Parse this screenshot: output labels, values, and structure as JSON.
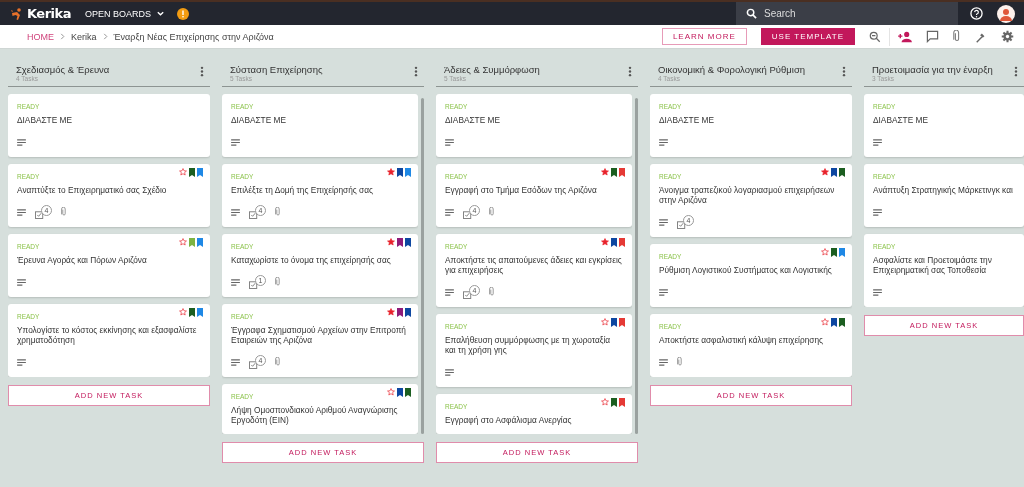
{
  "topbar": {
    "brand": "Kerika",
    "menu": "OPEN BOARDS",
    "search": {
      "placeholder": "Search"
    }
  },
  "breadcrumb": [
    {
      "label": "HOME",
      "kind": "link"
    },
    {
      "label": "Kerika",
      "kind": "text"
    },
    {
      "label": "Έναρξη Νέας Επιχείρησης στην Αριζόνα",
      "kind": "text"
    }
  ],
  "actions": [
    {
      "label": "LEARN MORE",
      "kind": "outline"
    },
    {
      "label": "USE TEMPLATE",
      "kind": "filled"
    }
  ],
  "columns": [
    {
      "title": "Σχεδιασμός & Έρευνα",
      "count": "4 Tasks",
      "scrollbar": false,
      "add_label": "ADD NEW TASK",
      "cards": [
        {
          "status": "READY",
          "title": "ΔΙΑΒΑΣΤΕ ΜΕ",
          "description": true,
          "attachment": false
        },
        {
          "status": "READY",
          "title": "Αναπτύξτε το Επιχειρηματικό σας Σχέδιο",
          "starred": false,
          "tags": [
            {
              "color": "#1b5e20"
            },
            {
              "color": "#1e88e5"
            }
          ],
          "description": true,
          "checklist": "4",
          "attachment": true
        },
        {
          "status": "READY",
          "title": "Έρευνα Αγοράς και Πόρων Αριζόνα",
          "starred": false,
          "tags": [
            {
              "color": "#7cb342"
            },
            {
              "color": "#1e88e5"
            }
          ],
          "description": true,
          "attachment": false
        },
        {
          "status": "READY",
          "title": "Υπολογίστε το κόστος εκκίνησης και εξασφαλίστε χρηματοδότηση",
          "starred": false,
          "tags": [
            {
              "color": "#1b5e20"
            },
            {
              "color": "#1e88e5"
            }
          ],
          "description": true,
          "attachment": false
        }
      ]
    },
    {
      "title": "Σύσταση Επιχείρησης",
      "count": "5 Tasks",
      "scrollbar": true,
      "add_label": "ADD NEW TASK",
      "cards": [
        {
          "status": "READY",
          "title": "ΔΙΑΒΑΣΤΕ ΜΕ",
          "description": true,
          "attachment": false
        },
        {
          "status": "READY",
          "title": "Επιλέξτε τη Δομή της Επιχείρησής σας",
          "starred": true,
          "tags": [
            {
              "color": "#0d47a1"
            },
            {
              "color": "#1e88e5"
            }
          ],
          "description": true,
          "checklist": "4",
          "attachment": true
        },
        {
          "status": "READY",
          "title": "Καταχωρίστε το όνομα της επιχείρησής σας",
          "starred": true,
          "tags": [
            {
              "color": "#8e1b7a"
            },
            {
              "color": "#0d47a1"
            }
          ],
          "description": true,
          "checklist": "1",
          "attachment": true
        },
        {
          "status": "READY",
          "title": "Έγγραφα Σχηματισμού Αρχείων στην Επιτροπή Εταιρειών της Αριζόνα",
          "starred": true,
          "tags": [
            {
              "color": "#8e1b7a"
            },
            {
              "color": "#0d47a1"
            }
          ],
          "description": true,
          "checklist": "4",
          "attachment": true
        },
        {
          "status": "READY",
          "title": "Λήψη Ομοσπονδιακού Αριθμού Αναγνώρισης Εργοδότη (EIN)",
          "starred": false,
          "tags": [
            {
              "color": "#0d47a1"
            },
            {
              "color": "#1b5e20"
            }
          ],
          "description": false,
          "attachment": false
        }
      ]
    },
    {
      "title": "Άδειες & Συμμόρφωση",
      "count": "5 Tasks",
      "scrollbar": true,
      "add_label": "ADD NEW TASK",
      "cards": [
        {
          "status": "READY",
          "title": "ΔΙΑΒΑΣΤΕ ΜΕ",
          "description": true,
          "attachment": false
        },
        {
          "status": "READY",
          "title": "Εγγραφή στο Τμήμα Εσόδων της Αριζόνα",
          "starred": true,
          "tags": [
            {
              "color": "#1b5e20"
            },
            {
              "color": "#e53935"
            }
          ],
          "description": true,
          "checklist": "4",
          "attachment": true
        },
        {
          "status": "READY",
          "title": "Αποκτήστε τις απαιτούμενες άδειες και εγκρίσεις για επιχειρήσεις",
          "starred": true,
          "tags": [
            {
              "color": "#0d47a1"
            },
            {
              "color": "#e53935"
            }
          ],
          "description": true,
          "checklist": "4",
          "attachment": true
        },
        {
          "status": "READY",
          "title": "Επαλήθευση συμμόρφωσης με τη χωροταξία και τη χρήση γης",
          "starred": false,
          "tags": [
            {
              "color": "#0d47a1"
            },
            {
              "color": "#e53935"
            }
          ],
          "description": true,
          "attachment": false
        },
        {
          "status": "READY",
          "title": "Εγγραφή στο Ασφάλισμα Ανεργίας",
          "starred": false,
          "tags": [
            {
              "color": "#1b5e20"
            },
            {
              "color": "#e53935"
            }
          ],
          "description": false,
          "attachment": false
        }
      ]
    },
    {
      "title": "Οικονομική & Φορολογική Ρύθμιση",
      "count": "4 Tasks",
      "scrollbar": false,
      "add_label": "ADD NEW TASK",
      "cards": [
        {
          "status": "READY",
          "title": "ΔΙΑΒΑΣΤΕ ΜΕ",
          "description": true,
          "attachment": false
        },
        {
          "status": "READY",
          "title": "Άνοιγμα τραπεζικού λογαριασμού επιχειρήσεων στην Αριζόνα",
          "starred": true,
          "tags": [
            {
              "color": "#0d47a1"
            },
            {
              "color": "#1b5e20"
            }
          ],
          "description": true,
          "checklist": "4",
          "attachment": false
        },
        {
          "status": "READY",
          "title": "Ρύθμιση Λογιστικού Συστήματος και Λογιστικής",
          "starred": false,
          "tags": [
            {
              "color": "#1b5e20"
            },
            {
              "color": "#1e88e5"
            }
          ],
          "description": true,
          "attachment": false
        },
        {
          "status": "READY",
          "title": "Αποκτήστε ασφαλιστική κάλυψη επιχείρησης",
          "starred": false,
          "tags": [
            {
              "color": "#0d47a1"
            },
            {
              "color": "#1b5e20"
            }
          ],
          "description": true,
          "attachment": true
        }
      ]
    },
    {
      "title": "Προετοιμασία για την έναρξη",
      "count": "3 Tasks",
      "scrollbar": false,
      "add_label": "ADD NEW TASK",
      "cards": [
        {
          "status": "READY",
          "title": "ΔΙΑΒΑΣΤΕ ΜΕ",
          "description": true,
          "attachment": false
        },
        {
          "status": "READY",
          "title": "Ανάπτυξη Στρατηγικής Μάρκετινγκ και",
          "description": true,
          "attachment": false
        },
        {
          "status": "READY",
          "title": "Ασφαλίστε και Προετοιμάστε την Επιχειρηματική σας Τοποθεσία",
          "description": true,
          "attachment": false
        }
      ]
    }
  ]
}
